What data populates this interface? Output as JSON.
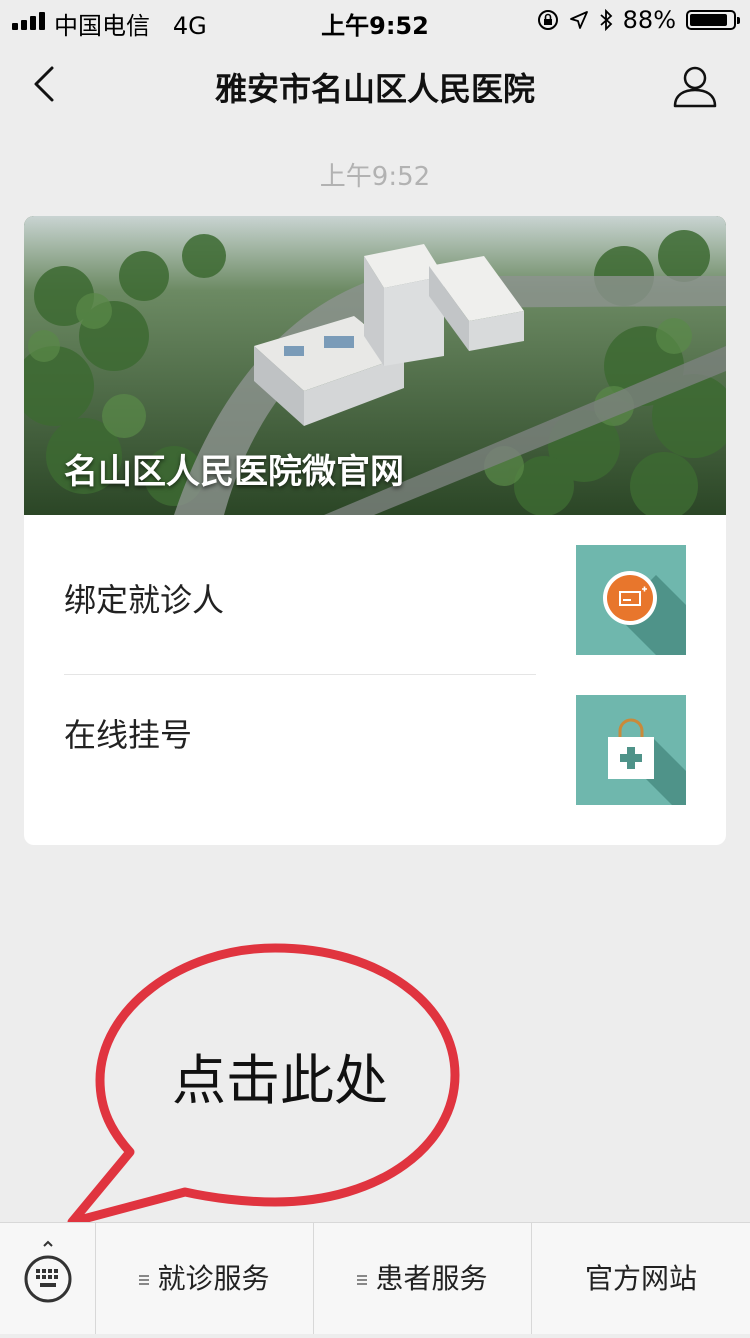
{
  "status_bar": {
    "carrier": "中国电信",
    "network": "4G",
    "time": "上午9:52",
    "battery": "88%",
    "battery_level": 0.88,
    "icons": [
      "signal-icon",
      "orientation-lock-icon",
      "location-icon",
      "bluetooth-icon",
      "battery-icon"
    ]
  },
  "nav": {
    "title": "雅安市名山区人民医院",
    "back_icon": "chevron-left-icon",
    "profile_icon": "person-icon"
  },
  "message_time": "上午9:52",
  "card": {
    "banner_title": "名山区人民医院微官网",
    "items": [
      {
        "label": "绑定就诊人",
        "icon": "id-card-icon"
      },
      {
        "label": "在线挂号",
        "icon": "medical-bag-icon"
      }
    ]
  },
  "annotation": {
    "text": "点击此处",
    "color": "#e0343f"
  },
  "bottom_menu": {
    "keyboard_icon": "keyboard-icon",
    "items": [
      "就诊服务",
      "患者服务",
      "官方网站"
    ]
  },
  "colors": {
    "accent_teal": "#6fb7ad",
    "accent_orange": "#e8762c",
    "background": "#ededed"
  }
}
